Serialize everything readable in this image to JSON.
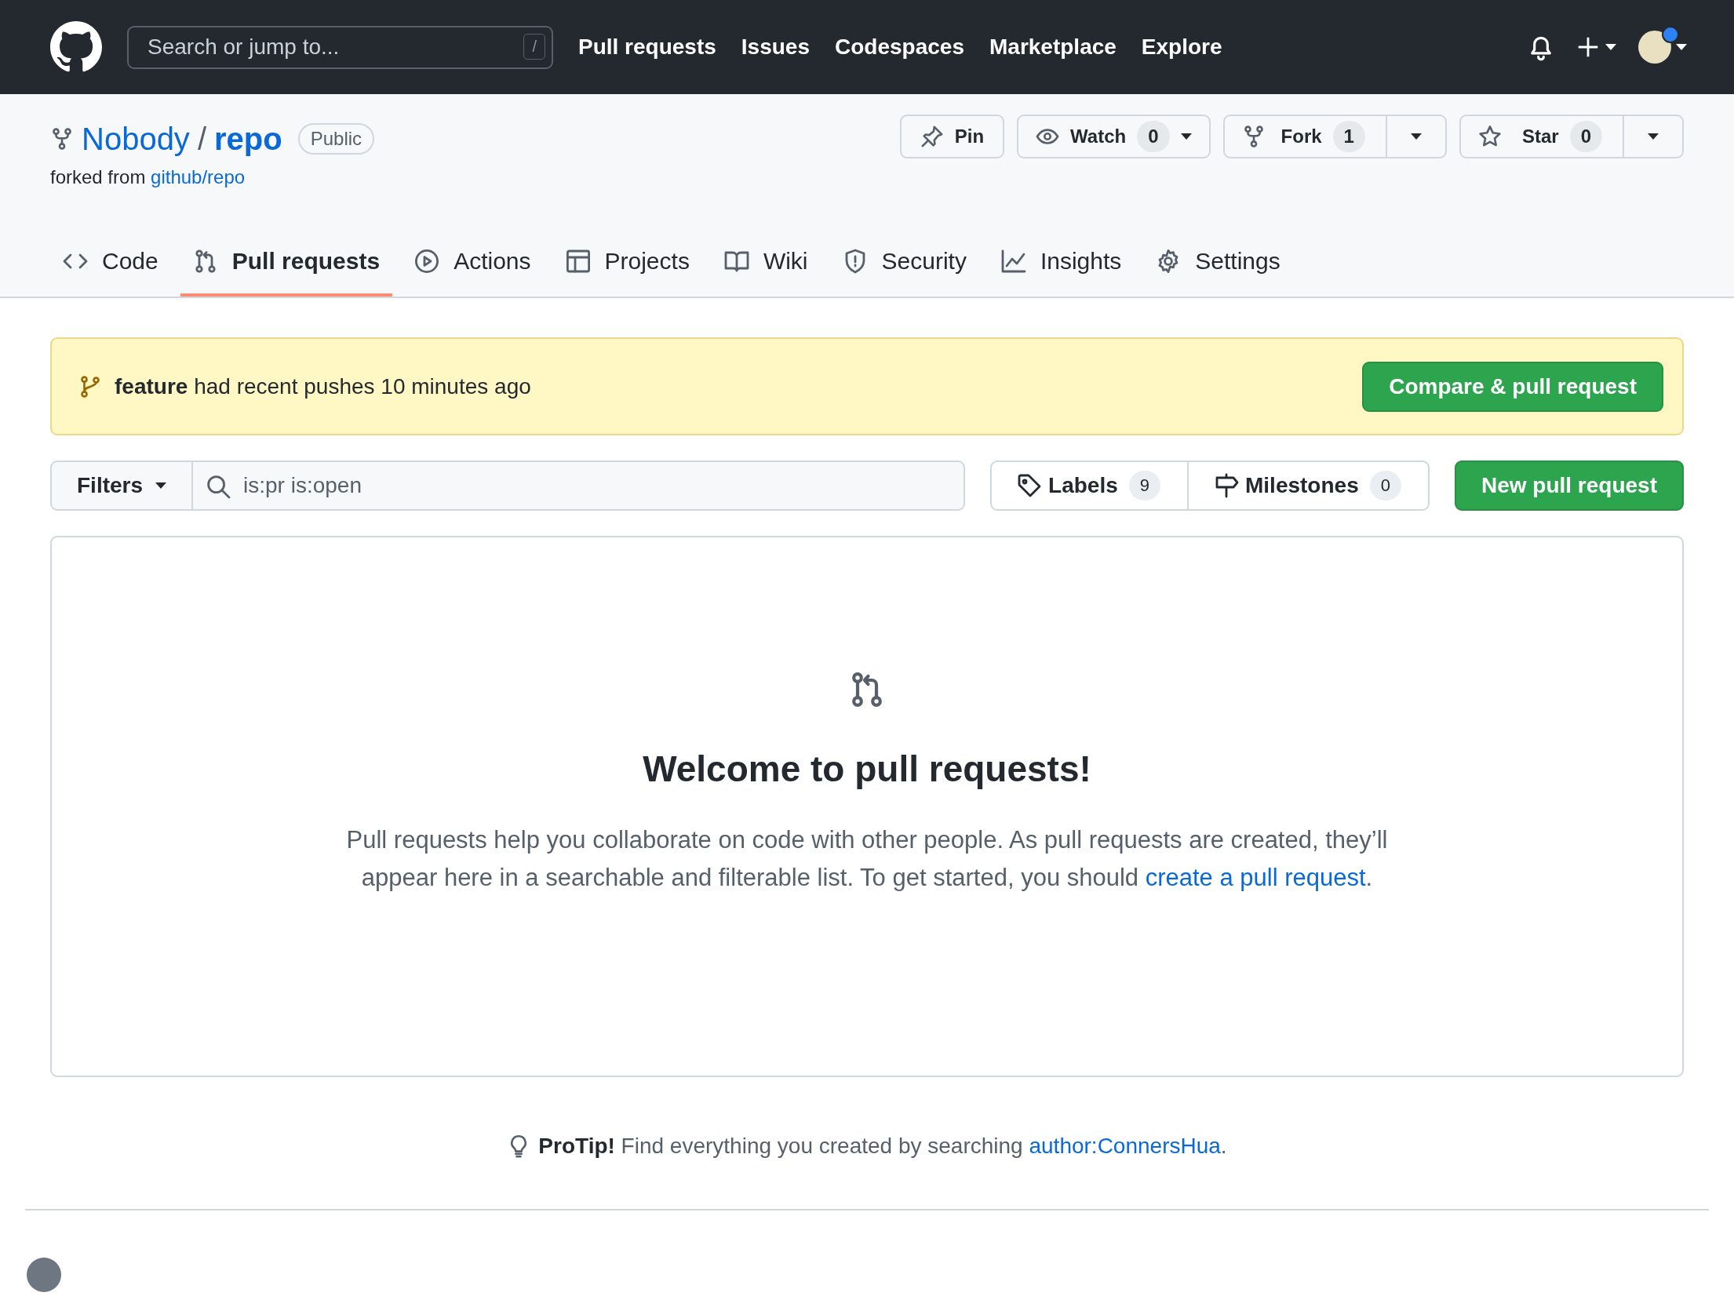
{
  "header": {
    "search_placeholder": "Search or jump to...",
    "search_key": "/",
    "nav": [
      "Pull requests",
      "Issues",
      "Codespaces",
      "Marketplace",
      "Explore"
    ],
    "has_notification": true
  },
  "repo": {
    "owner": "Nobody",
    "separator": "/",
    "name": "repo",
    "visibility": "Public",
    "forked_label": "forked from",
    "forked_from": "github/repo"
  },
  "repo_actions": [
    {
      "kind": "pin",
      "label": "Pin"
    },
    {
      "kind": "watch",
      "label": "Watch",
      "count": "0"
    },
    {
      "kind": "fork",
      "label": "Fork",
      "count": "1"
    },
    {
      "kind": "star",
      "label": "Star",
      "count": "0"
    }
  ],
  "tabs": [
    {
      "kind": "code",
      "label": "Code",
      "selected": false
    },
    {
      "kind": "pulls",
      "label": "Pull requests",
      "selected": true
    },
    {
      "kind": "actions",
      "label": "Actions",
      "selected": false
    },
    {
      "kind": "projects",
      "label": "Projects",
      "selected": false
    },
    {
      "kind": "wiki",
      "label": "Wiki",
      "selected": false
    },
    {
      "kind": "security",
      "label": "Security",
      "selected": false
    },
    {
      "kind": "insights",
      "label": "Insights",
      "selected": false
    },
    {
      "kind": "settings",
      "label": "Settings",
      "selected": false
    }
  ],
  "banner": {
    "text": "**feature** had recent pushes 10 minutes ago",
    "button": "Compare & pull request"
  },
  "toolbar": {
    "filters": "Filters",
    "search_value": "is:pr is:open",
    "labels": {
      "label": "Labels",
      "count": "9"
    },
    "milestones": {
      "label": "Milestones",
      "count": "0"
    },
    "new_button": "New pull request"
  },
  "blankslate": {
    "title": "Welcome to pull requests!",
    "text": "Pull requests help you collaborate on code with other people. As pull requests are created, they’ll appear here in a searchable and filterable list. To get started, you should ",
    "link": "create a pull request",
    "end": "."
  },
  "protip": {
    "text": "**ProTip!** Find everything you created by searching ",
    "link": "author:ConnersHua",
    "end": "."
  }
}
